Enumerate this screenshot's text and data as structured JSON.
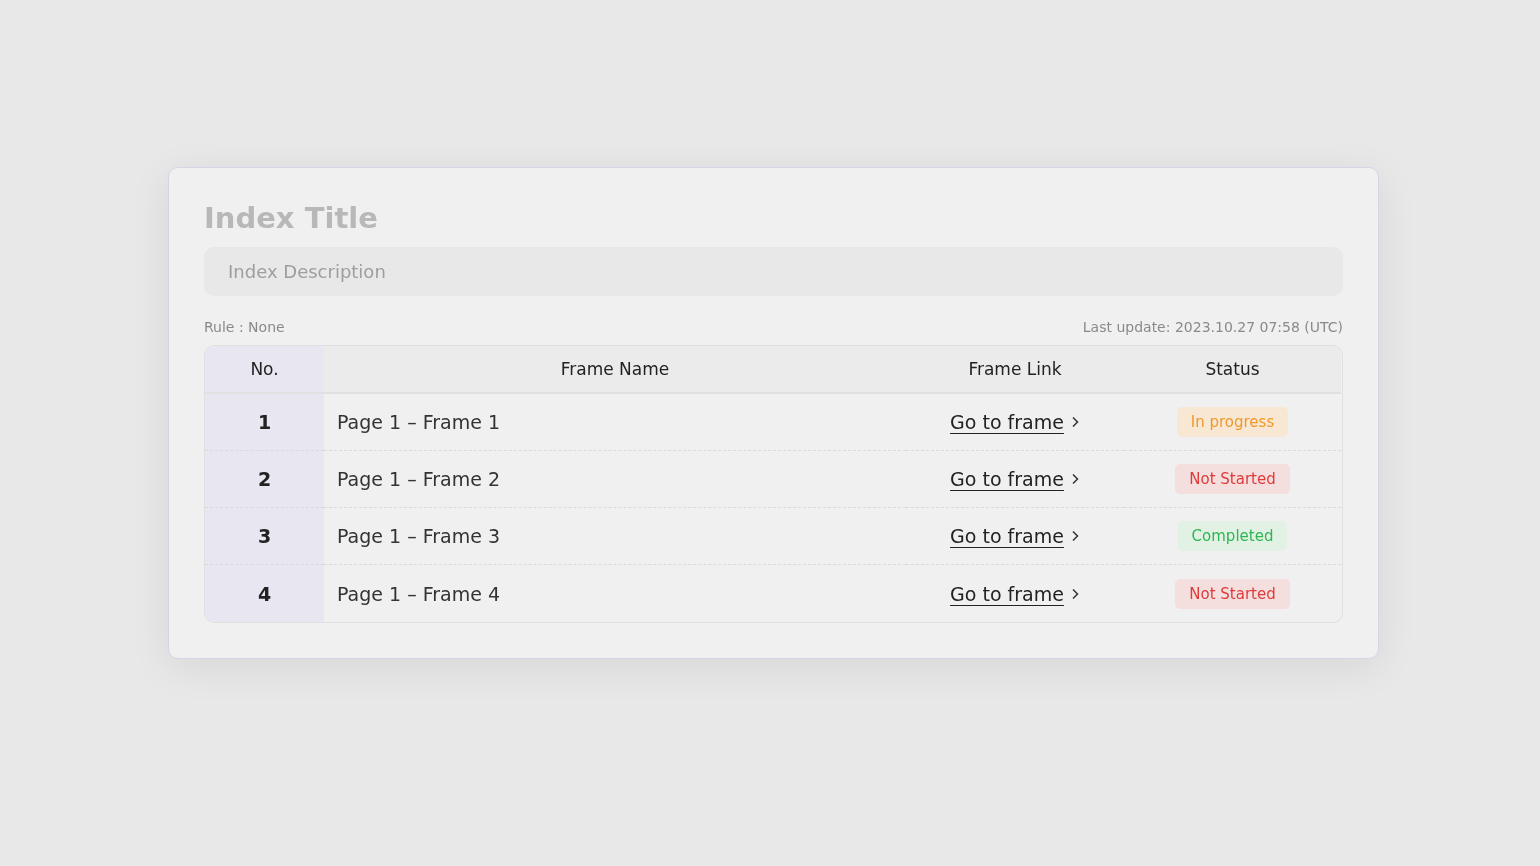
{
  "index": {
    "title": "Index Title",
    "description": {
      "placeholder": "Index Description"
    },
    "rule": "Rule : None",
    "last_update": "Last update: 2023.10.27 07:58 (UTC)"
  },
  "table": {
    "columns": [
      "No.",
      "Frame Name",
      "Frame Link",
      "Status"
    ],
    "rows": [
      {
        "no": "1",
        "frame_name": "Page 1 –  Frame 1",
        "link": "Go to frame",
        "status": {
          "label": "In progress",
          "kind": "in_progress"
        }
      },
      {
        "no": "2",
        "frame_name": "Page 1 –  Frame 2",
        "link": "Go to frame",
        "status": {
          "label": "Not Started",
          "kind": "not_started"
        }
      },
      {
        "no": "3",
        "frame_name": "Page 1 –  Frame 3",
        "link": "Go to frame",
        "status": {
          "label": "Completed",
          "kind": "completed"
        }
      },
      {
        "no": "4",
        "frame_name": "Page 1 –  Frame 4",
        "link": "Go to frame",
        "status": {
          "label": "Not Started",
          "kind": "not_started"
        }
      }
    ]
  }
}
